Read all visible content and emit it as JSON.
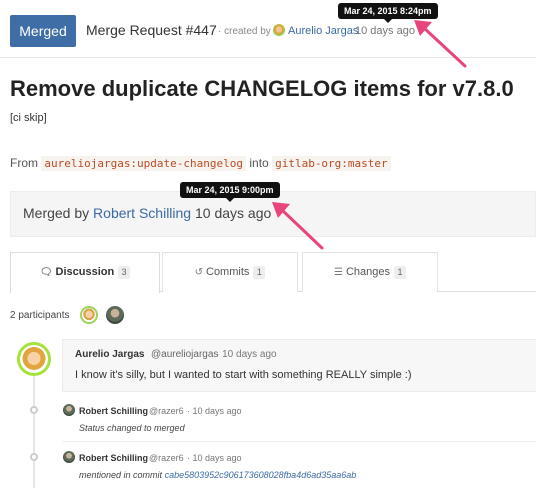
{
  "header": {
    "state": "Merged",
    "reference": "Merge Request #447",
    "created_by_prefix": "· created by",
    "author_name": "Aurelio Jargas",
    "created_time": "10 days ago",
    "created_tooltip": "Mar 24, 2015 8:24pm"
  },
  "mr": {
    "title": "Remove duplicate CHANGELOG items for v7.8.0",
    "description": "[ci skip]"
  },
  "branches": {
    "from_label": "From",
    "source": "aureliojargas:update-changelog",
    "into_label": "into",
    "target": "gitlab-org:master"
  },
  "merge_status": {
    "prefix": "Merged by",
    "merger": "Robert Schilling",
    "time": "10 days ago",
    "tooltip": "Mar 24, 2015 9:00pm"
  },
  "tabs": [
    {
      "label": "Discussion",
      "count": "3",
      "icon": "comments-icon"
    },
    {
      "label": "Commits",
      "count": "1",
      "icon": "history-icon"
    },
    {
      "label": "Changes",
      "count": "1",
      "icon": "list-icon"
    }
  ],
  "participants": {
    "label": "2 participants"
  },
  "notes": [
    {
      "author": "Aurelio Jargas",
      "handle": "@aureliojargas",
      "time": "· 10 days ago",
      "body": "I know it's silly, but I wanted to start with something REALLY simple :)"
    }
  ],
  "system_notes": [
    {
      "author": "Robert Schilling",
      "handle": "@razer6",
      "time": "· 10 days ago",
      "text": "Status changed to merged"
    },
    {
      "author": "Robert Schilling",
      "handle": "@razer6",
      "time": "· 10 days ago",
      "text": "mentioned in commit",
      "commit": "cabe5803952c906173608028fba4d6ad35aa6ab"
    }
  ],
  "colors": {
    "badge": "#3f6da5",
    "link": "#3c6aa6",
    "annotation_arrow": "#e8457d"
  }
}
